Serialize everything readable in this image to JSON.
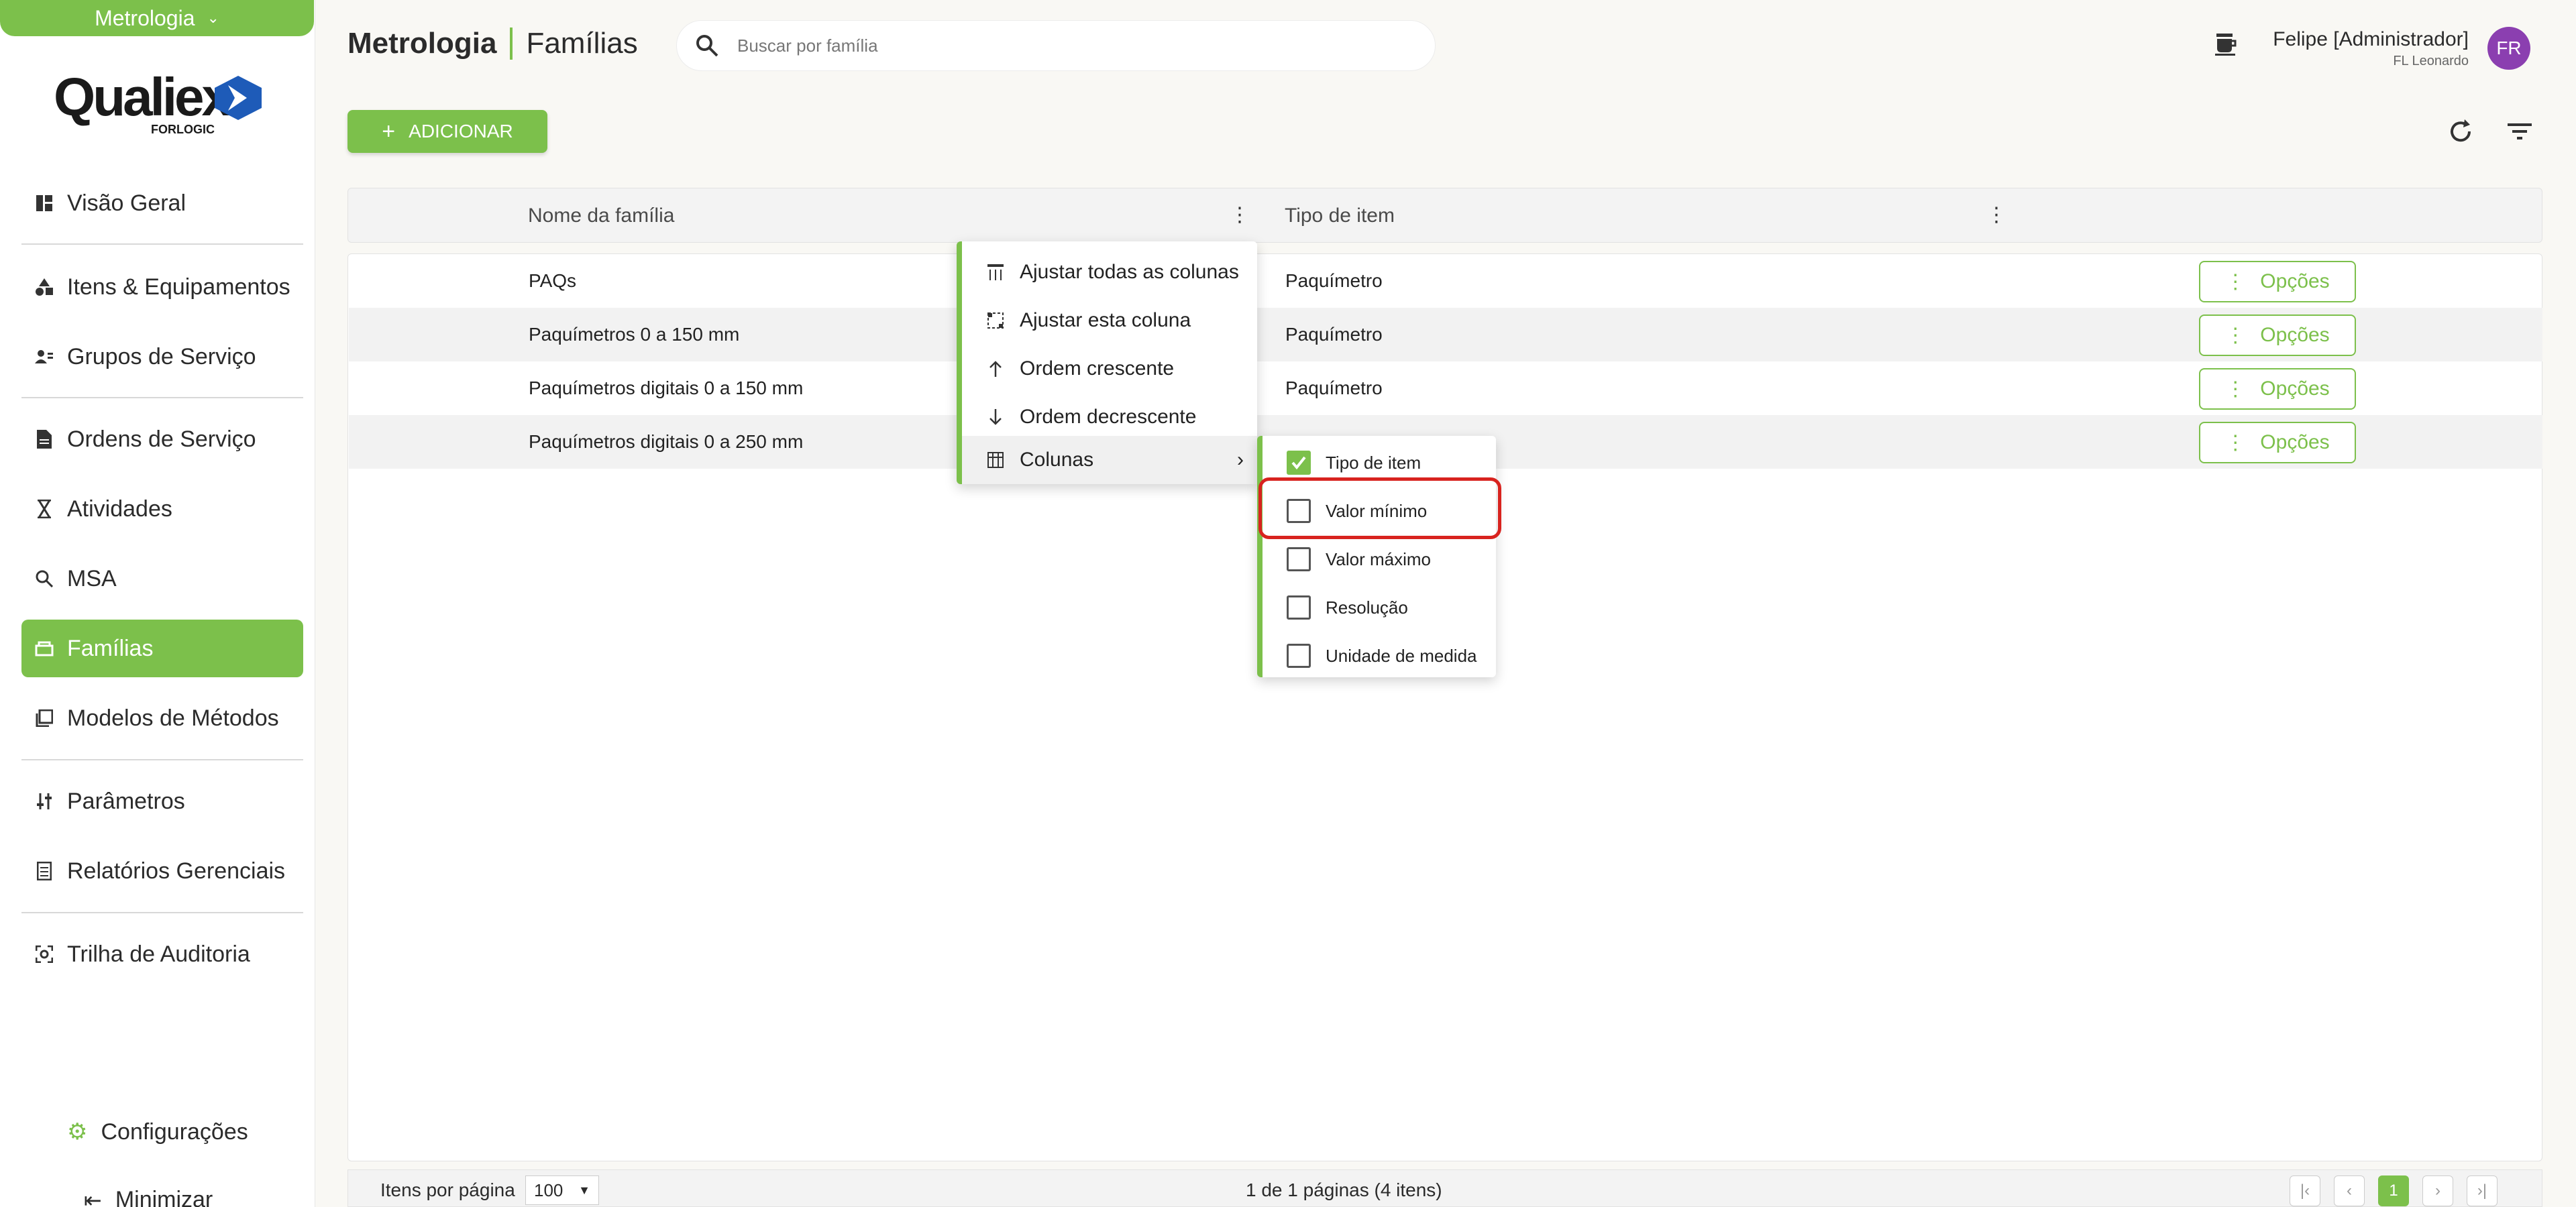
{
  "module": {
    "label": "Metrologia"
  },
  "logo": {
    "word": "Qualiex",
    "sub": "FORLOGIC"
  },
  "nav": [
    {
      "label": "Visão Geral",
      "icon": "dashboard-icon"
    },
    {
      "label": "Itens & Equipamentos",
      "icon": "shapes-icon"
    },
    {
      "label": "Grupos de Serviço",
      "icon": "group-icon"
    },
    {
      "label": "Ordens de Serviço",
      "icon": "document-icon"
    },
    {
      "label": "Atividades",
      "icon": "hourglass-icon"
    },
    {
      "label": "MSA",
      "icon": "zoom-icon"
    },
    {
      "label": "Famílias",
      "icon": "family-icon",
      "active": true
    },
    {
      "label": "Modelos de Métodos",
      "icon": "library-icon"
    },
    {
      "label": "Parâmetros",
      "icon": "sliders-icon"
    },
    {
      "label": "Relatórios Gerenciais",
      "icon": "report-icon"
    },
    {
      "label": "Trilha de Auditoria",
      "icon": "audit-icon"
    }
  ],
  "footer": {
    "config": "Configurações",
    "minimize": "Minimizar"
  },
  "header": {
    "module": "Metrologia",
    "page": "Famílias",
    "search_placeholder": "Buscar por família",
    "user_name": "Felipe [Administrador]",
    "user_org": "FL Leonardo",
    "avatar": "FR"
  },
  "toolbar": {
    "add_label": "ADICIONAR"
  },
  "grid": {
    "columns": [
      "Nome da família",
      "Tipo de item"
    ],
    "rows": [
      {
        "name": "PAQs",
        "type": "Paquímetro"
      },
      {
        "name": "Paquímetros 0 a 150 mm",
        "type": "Paquímetro"
      },
      {
        "name": "Paquímetros digitais 0 a 150 mm",
        "type": "Paquímetro"
      },
      {
        "name": "Paquímetros digitais 0 a 250 mm",
        "type": ""
      }
    ],
    "options_label": "Opções"
  },
  "menu": {
    "items": [
      {
        "label": "Ajustar todas as colunas",
        "icon": "fit-all-icon"
      },
      {
        "label": "Ajustar esta coluna",
        "icon": "fit-column-icon"
      },
      {
        "label": "Ordem crescente",
        "icon": "arrow-up-icon"
      },
      {
        "label": "Ordem decrescente",
        "icon": "arrow-down-icon"
      },
      {
        "label": "Colunas",
        "icon": "columns-icon"
      }
    ]
  },
  "submenu": {
    "items": [
      {
        "label": "Tipo de item",
        "checked": true
      },
      {
        "label": "Valor mínimo",
        "checked": false
      },
      {
        "label": "Valor máximo",
        "checked": false
      },
      {
        "label": "Resolução",
        "checked": false
      },
      {
        "label": "Unidade de medida",
        "checked": false
      }
    ]
  },
  "pager": {
    "label": "Itens por página",
    "page_size": "100",
    "info": "1 de 1 páginas (4 itens)",
    "current": "1"
  },
  "colors": {
    "accent": "#7cc04b",
    "avatar": "#8b3fb0",
    "highlight": "#d8231f"
  }
}
